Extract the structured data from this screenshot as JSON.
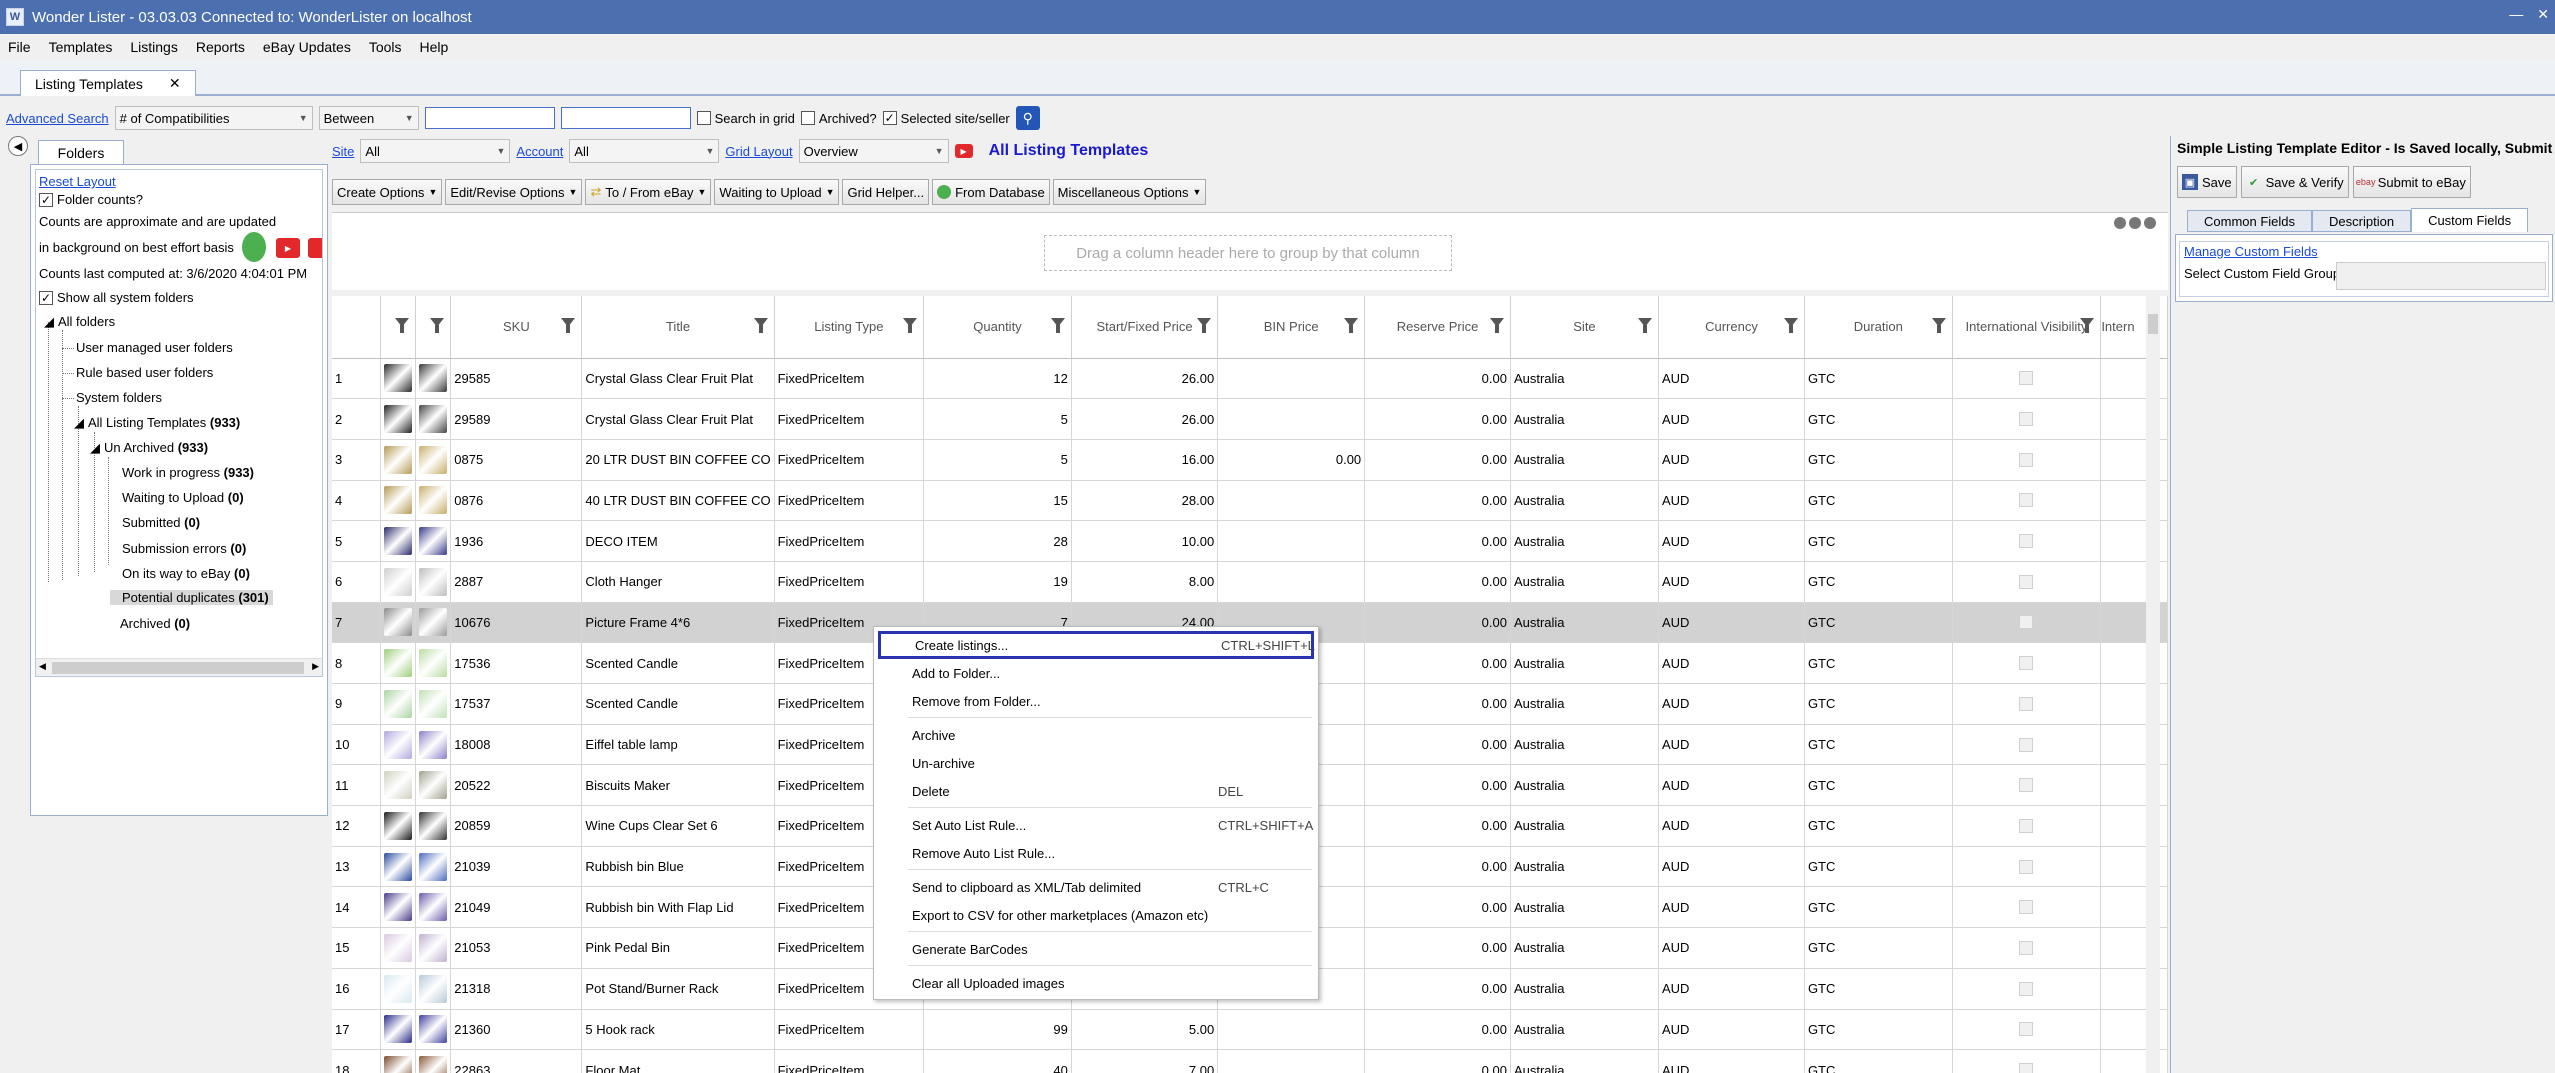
{
  "window": {
    "title": "Wonder Lister - 03.03.03 Connected to: WonderLister on localhost",
    "minimize": "—",
    "close": "✕"
  },
  "menu": [
    "File",
    "Templates",
    "Listings",
    "Reports",
    "eBay Updates",
    "Tools",
    "Help"
  ],
  "doc_tab": {
    "label": "Listing Templates",
    "close": "✕"
  },
  "search": {
    "advanced_label": "Advanced Search",
    "field_value": "# of Compatibilities",
    "operator_value": "Between",
    "value1": "",
    "value2": "",
    "search_in_grid": {
      "label": "Search in grid",
      "checked": false
    },
    "archived": {
      "label": "Archived?",
      "checked": false
    },
    "selected_site": {
      "label": "Selected site/seller",
      "checked": true
    }
  },
  "folders": {
    "tab_label": "Folders",
    "reset_layout": "Reset Layout",
    "folder_counts_label": "Folder counts?",
    "counts_note_1": "Counts are approximate and are updated",
    "counts_note_2": "in background on best effort basis",
    "counts_last": "Counts last computed at: 3/6/2020 4:04:01 PM",
    "show_all_label": "Show all system folders",
    "tree": {
      "all": "All folders",
      "user_managed": "User managed user folders",
      "rule_based": "Rule based user folders",
      "system": "System folders",
      "all_templates": "All Listing Templates",
      "all_templates_count": "(933)",
      "un_archived": "Un Archived",
      "un_archived_count": "(933)",
      "wip": "Work in progress",
      "wip_count": "(933)",
      "waiting": "Waiting to Upload",
      "waiting_count": "(0)",
      "submitted": "Submitted",
      "submitted_count": "(0)",
      "sub_errors": "Submission errors",
      "sub_errors_count": "(0)",
      "on_way": "On its way to eBay",
      "on_way_count": "(0)",
      "dupes": "Potential duplicates",
      "dupes_count": "(301)",
      "archived": "Archived",
      "archived_count": "(0)"
    }
  },
  "toolbar": {
    "site_label": "Site",
    "site_value": "All",
    "account_label": "Account",
    "account_value": "All",
    "grid_layout_label": "Grid Layout",
    "grid_layout_value": "Overview",
    "grid_title": "All Listing Templates",
    "buttons": [
      "Create Options",
      "Edit/Revise Options",
      "To / From eBay",
      "Waiting to Upload",
      "Grid Helper...",
      "From Database",
      "Miscellaneous Options"
    ],
    "group_hint": "Drag a column header here to group by that column"
  },
  "grid": {
    "columns": [
      "",
      "",
      "",
      "SKU",
      "Title",
      "Listing Type",
      "Quantity",
      "Start/Fixed Price",
      "BIN Price",
      "Reserve Price",
      "Site",
      "Currency",
      "Duration",
      "International Visibility",
      "Intern"
    ],
    "rows": [
      {
        "n": "1",
        "sku": "29585",
        "title": "Crystal Glass Clear Fruit Plat",
        "type": "FixedPriceItem",
        "qty": "12",
        "price": "26.00",
        "bin": "",
        "reserve": "0.00",
        "site": "Australia",
        "cur": "AUD",
        "dur": "GTC",
        "c1": "#2a2a2a",
        "c2": "#3a3a3a"
      },
      {
        "n": "2",
        "sku": "29589",
        "title": "Crystal Glass Clear Fruit Plat",
        "type": "FixedPriceItem",
        "qty": "5",
        "price": "26.00",
        "bin": "",
        "reserve": "0.00",
        "site": "Australia",
        "cur": "AUD",
        "dur": "GTC",
        "c1": "#222",
        "c2": "#444"
      },
      {
        "n": "3",
        "sku": "0875",
        "title": "20 LTR DUST BIN COFFEE CO",
        "type": "FixedPriceItem",
        "qty": "5",
        "price": "16.00",
        "bin": "0.00",
        "reserve": "0.00",
        "site": "Australia",
        "cur": "AUD",
        "dur": "GTC",
        "c1": "#b59a54",
        "c2": "#c8ae6a"
      },
      {
        "n": "4",
        "sku": "0876",
        "title": "40 LTR DUST BIN COFFEE CO",
        "type": "FixedPriceItem",
        "qty": "15",
        "price": "28.00",
        "bin": "",
        "reserve": "0.00",
        "site": "Australia",
        "cur": "AUD",
        "dur": "GTC",
        "c1": "#b59a54",
        "c2": "#c8ae6a"
      },
      {
        "n": "5",
        "sku": "1936",
        "title": "DECO ITEM",
        "type": "FixedPriceItem",
        "qty": "28",
        "price": "10.00",
        "bin": "",
        "reserve": "0.00",
        "site": "Australia",
        "cur": "AUD",
        "dur": "GTC",
        "c1": "#2a2a6a",
        "c2": "#3a3a8a"
      },
      {
        "n": "6",
        "sku": "2887",
        "title": "Cloth Hanger",
        "type": "FixedPriceItem",
        "qty": "19",
        "price": "8.00",
        "bin": "",
        "reserve": "0.00",
        "site": "Australia",
        "cur": "AUD",
        "dur": "GTC",
        "c1": "#cfcfcf",
        "c2": "#bdbdbd"
      },
      {
        "n": "7",
        "sku": "10676",
        "title": "Picture Frame 4*6",
        "type": "FixedPriceItem",
        "qty": "7",
        "price": "24.00",
        "bin": "",
        "reserve": "0.00",
        "site": "Australia",
        "cur": "AUD",
        "dur": "GTC",
        "c1": "#8a8a8a",
        "c2": "#9a9a9a"
      },
      {
        "n": "8",
        "sku": "17536",
        "title": "Scented Candle",
        "type": "FixedPriceItem",
        "qty": "",
        "price": "",
        "bin": "",
        "reserve": "0.00",
        "site": "Australia",
        "cur": "AUD",
        "dur": "GTC",
        "c1": "#9ccf7a",
        "c2": "#b9dca0"
      },
      {
        "n": "9",
        "sku": "17537",
        "title": "Scented Candle",
        "type": "FixedPriceItem",
        "qty": "",
        "price": "",
        "bin": "",
        "reserve": "0.00",
        "site": "Australia",
        "cur": "AUD",
        "dur": "GTC",
        "c1": "#a8d4a0",
        "c2": "#c0e0b4"
      },
      {
        "n": "10",
        "sku": "18008",
        "title": "Eiffel table lamp",
        "type": "FixedPriceItem",
        "qty": "",
        "price": "",
        "bin": "",
        "reserve": "0.00",
        "site": "Australia",
        "cur": "AUD",
        "dur": "GTC",
        "c1": "#b0a8e0",
        "c2": "#8a80c8"
      },
      {
        "n": "11",
        "sku": "20522",
        "title": "Biscuits Maker",
        "type": "FixedPriceItem",
        "qty": "",
        "price": "",
        "bin": "",
        "reserve": "0.00",
        "site": "Australia",
        "cur": "AUD",
        "dur": "GTC",
        "c1": "#d0d0c0",
        "c2": "#a0a090"
      },
      {
        "n": "12",
        "sku": "20859",
        "title": "Wine Cups Clear Set 6",
        "type": "FixedPriceItem",
        "qty": "",
        "price": "",
        "bin": "",
        "reserve": "0.00",
        "site": "Australia",
        "cur": "AUD",
        "dur": "GTC",
        "c1": "#1a1a1a",
        "c2": "#333"
      },
      {
        "n": "13",
        "sku": "21039",
        "title": "Rubbish bin Blue",
        "type": "FixedPriceItem",
        "qty": "",
        "price": "",
        "bin": "",
        "reserve": "0.00",
        "site": "Australia",
        "cur": "AUD",
        "dur": "GTC",
        "c1": "#2a4aa0",
        "c2": "#4a6ac0"
      },
      {
        "n": "14",
        "sku": "21049",
        "title": "Rubbish bin With Flap Lid",
        "type": "FixedPriceItem",
        "qty": "",
        "price": "",
        "bin": "",
        "reserve": "0.00",
        "site": "Australia",
        "cur": "AUD",
        "dur": "GTC",
        "c1": "#4a3a8a",
        "c2": "#6a5aaa"
      },
      {
        "n": "15",
        "sku": "21053",
        "title": "Pink Pedal Bin",
        "type": "FixedPriceItem",
        "qty": "",
        "price": "",
        "bin": "",
        "reserve": "0.00",
        "site": "Australia",
        "cur": "AUD",
        "dur": "GTC",
        "c1": "#d8c8e0",
        "c2": "#c0b0d0"
      },
      {
        "n": "16",
        "sku": "21318",
        "title": "Pot Stand/Burner Rack",
        "type": "FixedPriceItem",
        "qty": "",
        "price": "",
        "bin": "",
        "reserve": "0.00",
        "site": "Australia",
        "cur": "AUD",
        "dur": "GTC",
        "c1": "#d8e8f0",
        "c2": "#b8c8d8"
      },
      {
        "n": "17",
        "sku": "21360",
        "title": "5 Hook rack",
        "type": "FixedPriceItem",
        "qty": "99",
        "price": "5.00",
        "bin": "",
        "reserve": "0.00",
        "site": "Australia",
        "cur": "AUD",
        "dur": "GTC",
        "c1": "#2a2a8a",
        "c2": "#4040a0"
      },
      {
        "n": "18",
        "sku": "22863",
        "title": "Floor Mat",
        "type": "FixedPriceItem",
        "qty": "40",
        "price": "7.00",
        "bin": "",
        "reserve": "0.00",
        "site": "Australia",
        "cur": "AUD",
        "dur": "GTC",
        "c1": "#7a4a2a",
        "c2": "#8a5a3a"
      }
    ]
  },
  "context_menu": {
    "create": "Create listings...",
    "create_sc": "CTRL+SHIFT+L",
    "add_folder": "Add to Folder...",
    "remove_folder": "Remove from Folder...",
    "archive": "Archive",
    "unarchive": "Un-archive",
    "delete": "Delete",
    "delete_sc": "DEL",
    "set_auto": "Set Auto List Rule...",
    "set_auto_sc": "CTRL+SHIFT+A",
    "remove_auto": "Remove Auto List Rule...",
    "clipboard": "Send to clipboard as XML/Tab delimited",
    "clipboard_sc": "CTRL+C",
    "export_csv": "Export to CSV for other marketplaces (Amazon etc)",
    "barcodes": "Generate BarCodes",
    "clear_images": "Clear all Uploaded images"
  },
  "editor": {
    "title": "Simple Listing Template Editor - Is Saved locally, Submit will create",
    "save": "Save",
    "save_verify": "Save & Verify",
    "submit": "Submit to eBay",
    "tabs": [
      "Common Fields",
      "Description",
      "Custom Fields"
    ],
    "manage_link": "Manage Custom Fields",
    "group_label": "Select Custom Field Group:"
  },
  "colors": {
    "titlebar": "#4c6fb0",
    "link": "#1a4bd6",
    "highlight": "#2b32b2"
  }
}
